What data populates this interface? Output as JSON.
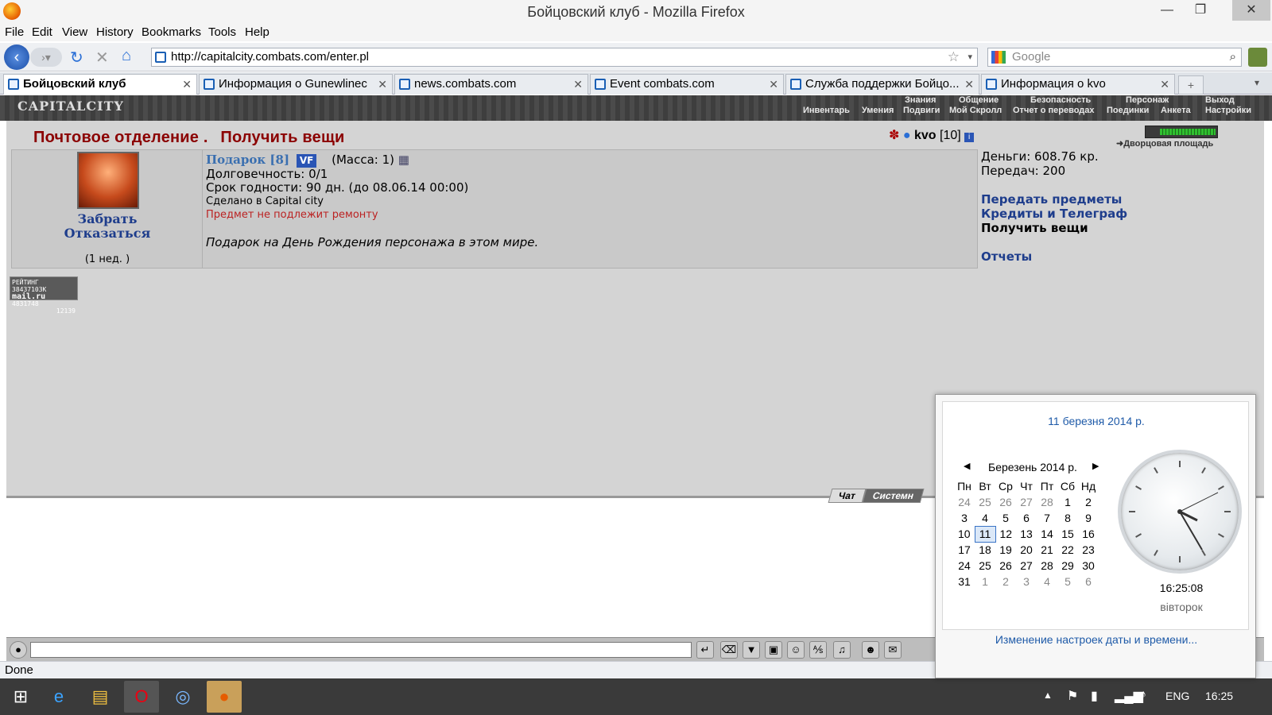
{
  "window": {
    "title": "Бойцовский клуб - Mozilla Firefox"
  },
  "menu": [
    "File",
    "Edit",
    "View",
    "History",
    "Bookmarks",
    "Tools",
    "Help"
  ],
  "nav": {
    "url": "http://capitalcity.combats.com/enter.pl",
    "search_placeholder": "Google"
  },
  "tabs": [
    {
      "label": "Бойцовский клуб"
    },
    {
      "label": "Информация о Gunewlinec"
    },
    {
      "label": "news.combats.com"
    },
    {
      "label": "Event combats.com"
    },
    {
      "label": "Служба поддержки Бойцо..."
    },
    {
      "label": "Информация о kvo"
    }
  ],
  "game": {
    "logo": "CAPITALCITY",
    "top_menu": [
      "Знания",
      "Общение",
      "Безопасность",
      "Персонаж",
      "Выход"
    ],
    "sub_menu": [
      "Инвентарь",
      "Умения",
      "Подвиги",
      "Мой Скролл",
      "Отчет о переводах",
      "Поединки",
      "Анкета",
      "Настройки"
    ],
    "location": "Дворцовая площадь"
  },
  "page": {
    "title_a": "Почтовое отделение .",
    "title_b": "Получить вещи",
    "user": {
      "name": "kvo",
      "level": "[10]"
    }
  },
  "item": {
    "name": "Подарок [8]",
    "badge": "VF",
    "mass": "(Масса: 1)",
    "durability": "Долговечность: 0/1",
    "expiry": "Срок годности: 90 дн. (до 08.06.14 00:00)",
    "made": "Сделано в Capital city",
    "repair": "Предмет не подлежит ремонту",
    "desc": "Подарок на День Рождения персонажа в этом мире.",
    "take": "Забрать",
    "refuse": "Отказаться",
    "period": "(1 нед. )"
  },
  "sidebar": {
    "money": "Деньги: 608.76 кр.",
    "transfers": "Передач: 200",
    "link1": "Передать предметы",
    "link2": "Кредиты и Телеграф",
    "link3": "Получить вещи",
    "link4": "Отчеты"
  },
  "counter": {
    "line1": "РЕЙТИНГ 38437103K",
    "line2": "4831748",
    "line3": "12139",
    "brand": "mail.ru"
  },
  "chat": {
    "tab1": "Чат",
    "tab2": "Системн"
  },
  "status": "Done",
  "taskbar": {
    "lang": "ENG",
    "time": "16:25"
  },
  "calendar": {
    "full_date": "11 березня 2014 р.",
    "month": "Березень 2014 р.",
    "weekdays": [
      "Пн",
      "Вт",
      "Ср",
      "Чт",
      "Пт",
      "Сб",
      "Нд"
    ],
    "weeks": [
      [
        "24",
        "25",
        "26",
        "27",
        "28",
        "1",
        "2"
      ],
      [
        "3",
        "4",
        "5",
        "6",
        "7",
        "8",
        "9"
      ],
      [
        "10",
        "11",
        "12",
        "13",
        "14",
        "15",
        "16"
      ],
      [
        "17",
        "18",
        "19",
        "20",
        "21",
        "22",
        "23"
      ],
      [
        "24",
        "25",
        "26",
        "27",
        "28",
        "29",
        "30"
      ],
      [
        "31",
        "1",
        "2",
        "3",
        "4",
        "5",
        "6"
      ]
    ],
    "time": "16:25:08",
    "day": "вівторок",
    "settings": "Изменение настроек даты и времени..."
  }
}
